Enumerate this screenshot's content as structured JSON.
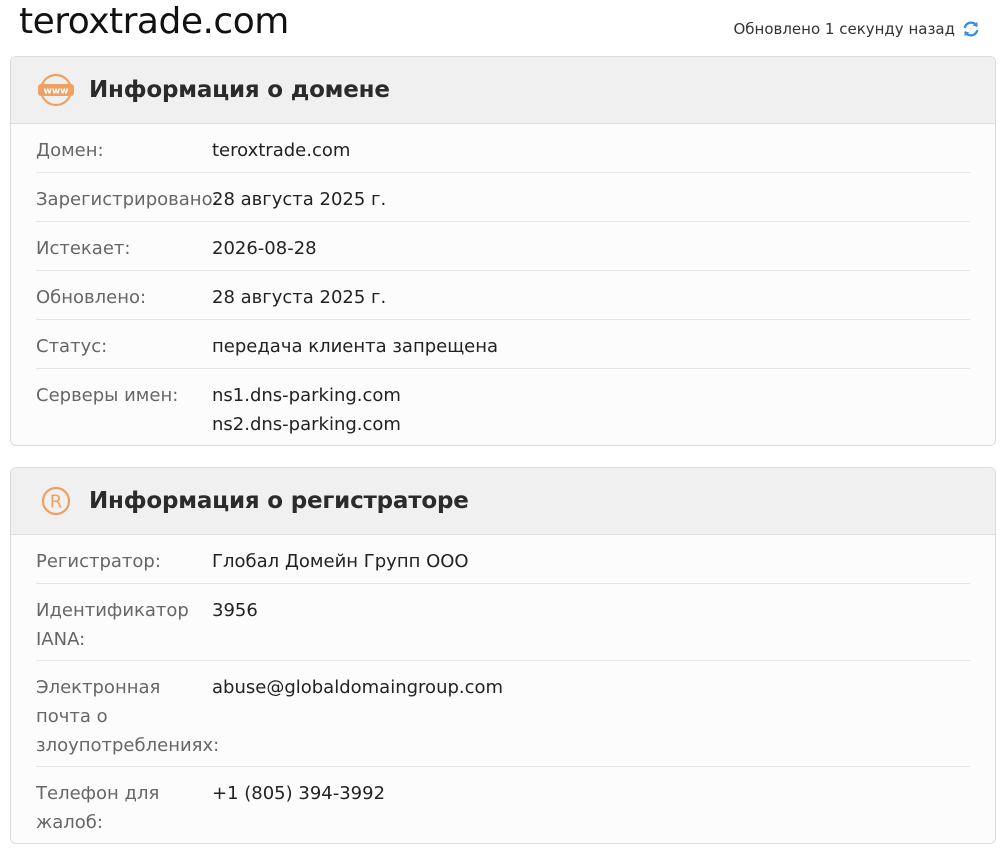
{
  "header": {
    "domain": "teroxtrade.com",
    "updated_text": "Обновлено 1 секунду назад"
  },
  "domain_card": {
    "title": "Информация о домене",
    "icon": "www-icon",
    "rows": [
      {
        "label": "Домен:",
        "value": "teroxtrade.com"
      },
      {
        "label": "Зарегистрировано:",
        "value": "28 августа 2025 г."
      },
      {
        "label": "Истекает:",
        "value": "2026-08-28"
      },
      {
        "label": "Обновлено:",
        "value": "28 августа 2025 г."
      },
      {
        "label": "Статус:",
        "value": "передача клиента запрещена"
      },
      {
        "label": "Серверы имен:",
        "values": [
          "ns1.dns-parking.com",
          "ns2.dns-parking.com"
        ]
      }
    ]
  },
  "registrar_card": {
    "title": "Информация о регистраторе",
    "icon": "registered-icon",
    "rows": [
      {
        "label": "Регистратор:",
        "value": "Глобал Домейн Групп ООО"
      },
      {
        "label": "Идентификатор IANA:",
        "value": "3956"
      },
      {
        "label": "Электронная почта о злоупотреблениях:",
        "value": "abuse@globaldomaingroup.com"
      },
      {
        "label": "Телефон для жалоб:",
        "value": "+1 (805) 394-3992"
      }
    ]
  },
  "colors": {
    "accent_icon": "#f0a060",
    "refresh_icon": "#3a8ee6"
  }
}
